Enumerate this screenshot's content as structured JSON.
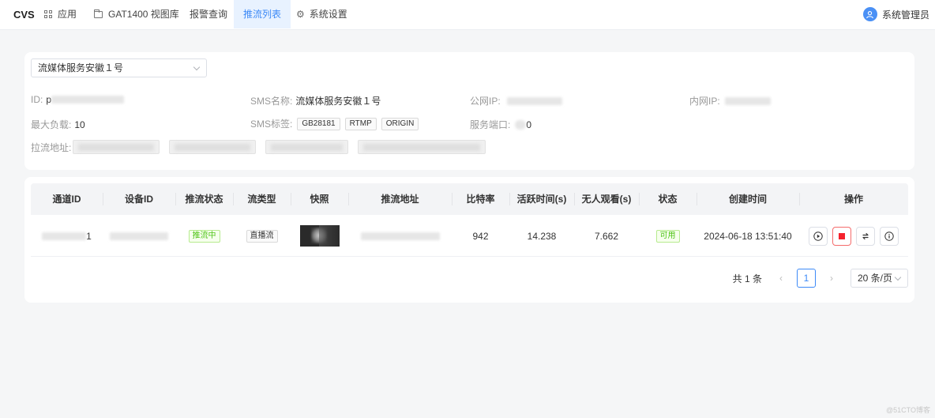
{
  "app": {
    "logo": "CVS"
  },
  "nav": [
    {
      "label": "应用",
      "icon": "grid-icon"
    },
    {
      "label": "GAT1400 视图库",
      "icon": "folder-icon"
    },
    {
      "label": "报警查询"
    },
    {
      "label": "推流列表",
      "active": true
    },
    {
      "label": "系统设置",
      "icon": "gear-icon"
    }
  ],
  "user": {
    "name": "系统管理员",
    "icon": "user-icon"
  },
  "server_select": {
    "value": "流媒体服务安徽１号"
  },
  "info": {
    "id_label": "ID:",
    "id_value_prefix": "p",
    "sms_name_label": "SMS名称:",
    "sms_name_value": "流媒体服务安徽１号",
    "public_ip_label": "公网IP:",
    "private_ip_label": "内网IP:",
    "max_load_label": "最大负载:",
    "max_load_value": "10",
    "sms_tags_label": "SMS标签:",
    "tags": [
      "GB28181",
      "RTMP",
      "ORIGIN"
    ],
    "port_label": "服务端口:",
    "port_value_suffix": "0",
    "pull_addr_label": "拉流地址:"
  },
  "table": {
    "headers": [
      "通道ID",
      "设备ID",
      "推流状态",
      "流类型",
      "快照",
      "推流地址",
      "比特率",
      "活跃时间(s)",
      "无人观看(s)",
      "状态",
      "创建时间",
      "操作"
    ],
    "rows": [
      {
        "channel_id_suffix": "1",
        "push_status": "推流中",
        "stream_type": "直播流",
        "bitrate": "942",
        "active_time": "14.238",
        "idle_time": "7.662",
        "status": "可用",
        "created": "2024-06-18 13:51:40"
      }
    ],
    "actions": [
      "play-icon",
      "stop-icon",
      "switch-icon",
      "info-icon"
    ]
  },
  "pagination": {
    "total": "共 1 条",
    "current": "1",
    "page_size": "20 条/页"
  },
  "colors": {
    "accent": "#3d8af7",
    "success": "#52c41a",
    "danger": "#f56c6c"
  },
  "watermark": "@51CTO博客"
}
